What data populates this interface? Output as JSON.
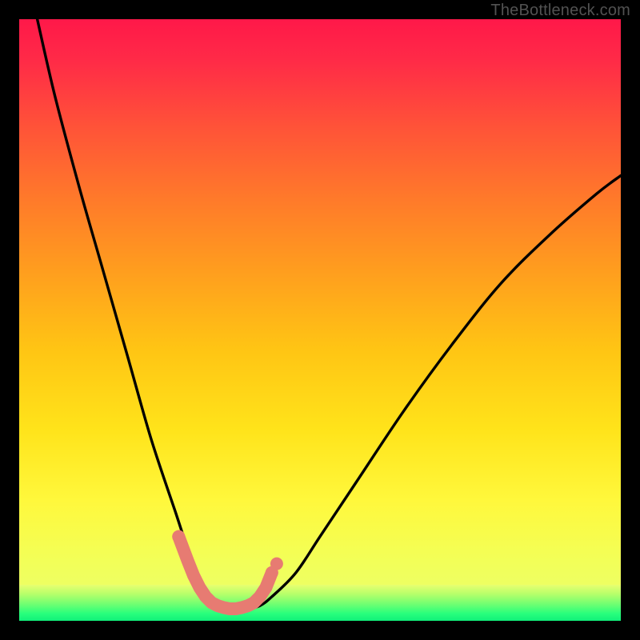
{
  "watermark": "TheBottleneck.com",
  "accent_colors": {
    "top": "#ff1a4b",
    "upper_mid": "#ff7a2a",
    "mid": "#ffd31a",
    "lower_mid": "#f5ff4a",
    "green_band": "#2bff78",
    "marker": "#e77b72",
    "curve": "#000000"
  },
  "chart_data": {
    "type": "line",
    "title": "",
    "xlabel": "",
    "ylabel": "",
    "xlim": [
      0,
      100
    ],
    "ylim": [
      0,
      100
    ],
    "series": [
      {
        "name": "bottleneck-curve",
        "x": [
          3,
          6,
          10,
          14,
          18,
          22,
          26,
          28,
          30,
          32,
          34,
          36,
          38,
          40,
          42,
          46,
          50,
          56,
          64,
          72,
          80,
          88,
          96,
          100
        ],
        "y": [
          100,
          87,
          72,
          58,
          44,
          30,
          18,
          12,
          7,
          4,
          2.5,
          2,
          2,
          2.5,
          4,
          8,
          14,
          23,
          35,
          46,
          56,
          64,
          71,
          74
        ]
      }
    ],
    "markers": {
      "name": "highlight-points",
      "x": [
        26.5,
        28,
        29,
        30,
        31,
        32,
        33,
        34,
        35,
        36,
        37,
        38,
        39,
        40,
        41,
        42
      ],
      "y": [
        14,
        10,
        7.5,
        5.5,
        4,
        3,
        2.5,
        2.2,
        2,
        2,
        2.2,
        2.5,
        3,
        4,
        5.5,
        8
      ]
    },
    "green_band_y_range": [
      0,
      6
    ],
    "grid": false,
    "legend": false
  }
}
